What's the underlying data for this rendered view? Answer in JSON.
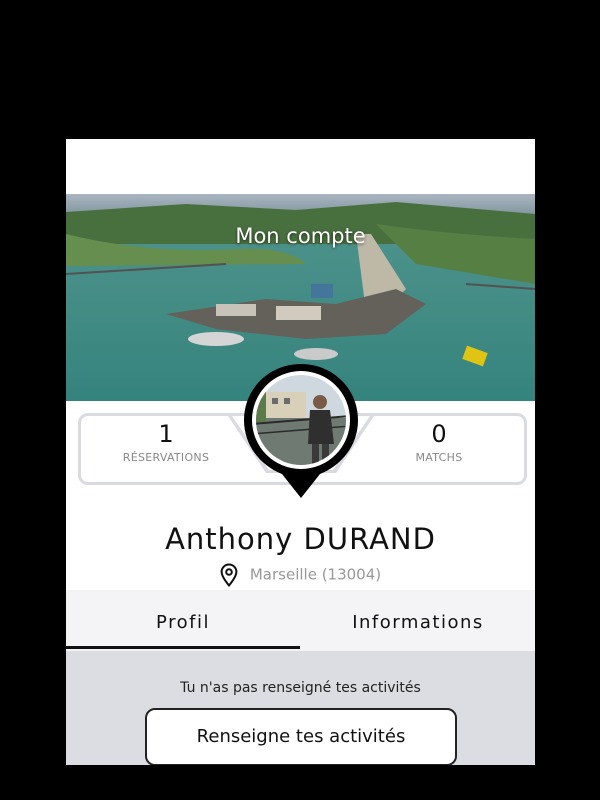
{
  "header": {
    "title": "Mon compte"
  },
  "stats": {
    "reservations": {
      "value": "1",
      "label": "RÉSERVATIONS"
    },
    "matchs": {
      "value": "0",
      "label": "MATCHS"
    }
  },
  "profile": {
    "name": "Anthony  DURAND",
    "location": "Marseille (13004)"
  },
  "tabs": [
    {
      "label": "Profil",
      "active": true
    },
    {
      "label": "Informations",
      "active": false
    }
  ],
  "content": {
    "message": "Tu n'as pas renseigné tes activités",
    "cta_label": "Renseigne tes activités"
  },
  "icons": {
    "location": "location-pin-icon"
  },
  "colors": {
    "tab_active": "#111111",
    "content_bg": "#dcdde2"
  }
}
